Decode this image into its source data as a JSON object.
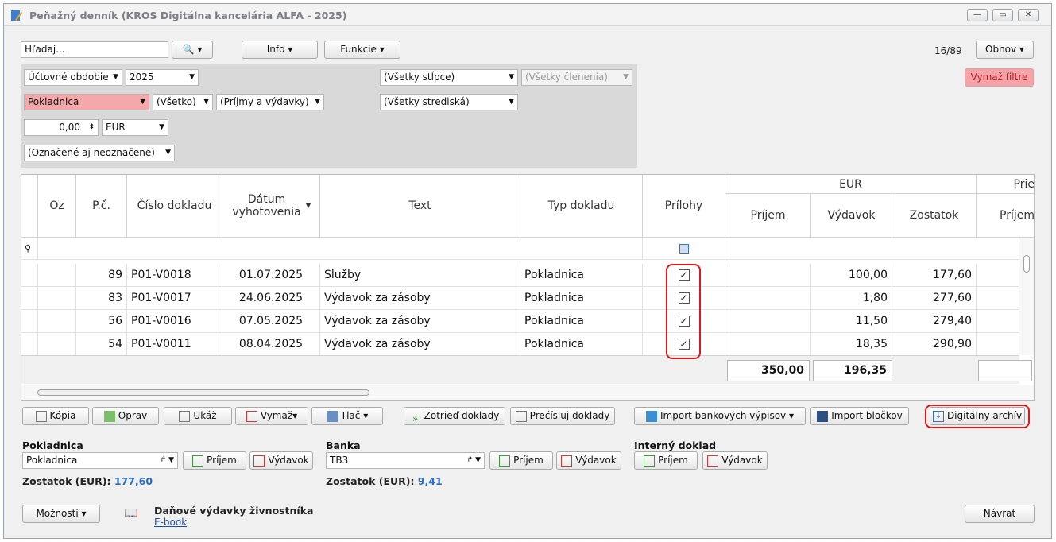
{
  "window": {
    "title": "Peňažný denník (KROS Digitálna kancelária ALFA - 2025)"
  },
  "toolbar": {
    "search_placeholder": "Hľadaj...",
    "info": "Info",
    "functions": "Funkcie",
    "counter": "16/89",
    "refresh": "Obnov",
    "clear_filters": "Vymaž filtre"
  },
  "filters": {
    "period_type": "Účtovné obdobie",
    "year": "2025",
    "columns": "(Všetky stĺpce)",
    "breakdown": "(Všetky členenia)",
    "book": "Pokladnica",
    "all": "(Všetko)",
    "income_expense": "(Príjmy a výdavky)",
    "centers": "(Všetky strediská)",
    "amount": "0,00",
    "currency": "EUR",
    "marked": "(Označené aj neoznačené)"
  },
  "grid": {
    "group_eur": "EUR",
    "group_prie": "Prie",
    "headers": {
      "oz": "Oz",
      "pc": "P.č.",
      "doc": "Číslo dokladu",
      "date": "Dátum vyhotovenia",
      "text": "Text",
      "type": "Typ dokladu",
      "att": "Prílohy",
      "inc": "Príjem",
      "exp": "Výdavok",
      "bal": "Zostatok",
      "inc2": "Príjem"
    },
    "rows": [
      {
        "pc": "89",
        "doc": "P01-V0018",
        "date": "01.07.2025",
        "text": "Služby",
        "type": "Pokladnica",
        "exp": "100,00",
        "bal": "177,60"
      },
      {
        "pc": "83",
        "doc": "P01-V0017",
        "date": "24.06.2025",
        "text": "Výdavok za zásoby",
        "type": "Pokladnica",
        "exp": "1,80",
        "bal": "277,60"
      },
      {
        "pc": "56",
        "doc": "P01-V0016",
        "date": "07.05.2025",
        "text": "Výdavok za zásoby",
        "type": "Pokladnica",
        "exp": "11,50",
        "bal": "279,40"
      },
      {
        "pc": "54",
        "doc": "P01-V0011",
        "date": "08.04.2025",
        "text": "Výdavok za zásoby",
        "type": "Pokladnica",
        "exp": "18,35",
        "bal": "290,90"
      }
    ],
    "totals": {
      "inc": "350,00",
      "exp": "196,35"
    }
  },
  "actions": {
    "copy": "Kópia",
    "edit": "Oprav",
    "show": "Ukáž",
    "delete": "Vymaž",
    "print": "Tlač",
    "sort": "Zotrieď doklady",
    "renumber": "Prečísluj doklady",
    "import_bank": "Import bankových výpisov",
    "import_receipts": "Import bločkov",
    "archive": "Digitálny archív"
  },
  "bottom": {
    "cash": {
      "label": "Pokladnica",
      "value": "Pokladnica",
      "balance_label": "Zostatok (EUR):",
      "balance": "177,60"
    },
    "bank": {
      "label": "Banka",
      "value": "TB3",
      "balance_label": "Zostatok (EUR):",
      "balance": "9,41"
    },
    "internal": {
      "label": "Interný doklad"
    },
    "income": "Príjem",
    "expense": "Výdavok",
    "options": "Možnosti",
    "ebook_title": "Daňové výdavky živnostníka",
    "ebook_link": "E-book",
    "back": "Návrat"
  }
}
